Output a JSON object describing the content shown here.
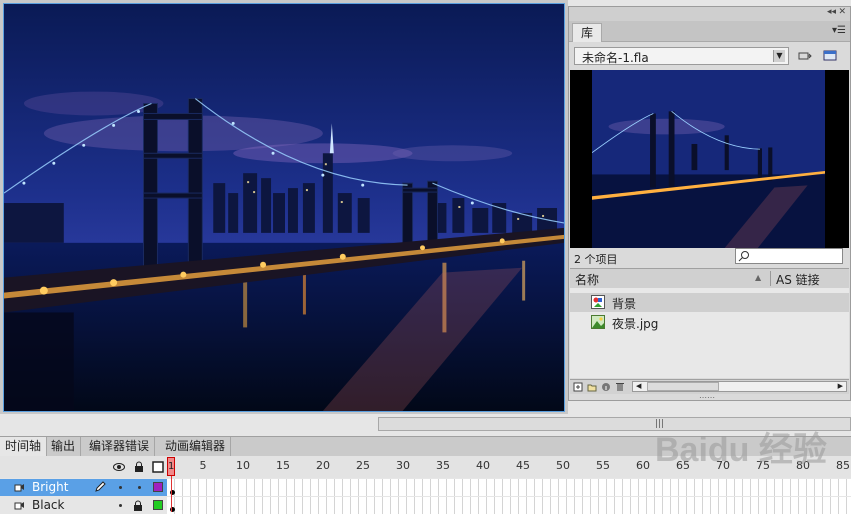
{
  "library": {
    "tab": "库",
    "document": "未命名-1.fla",
    "items_count": "2 个项目",
    "col_name": "名称",
    "col_linkage": "AS 链接",
    "items": [
      {
        "name": "背景",
        "icon": "graphic-symbol-icon",
        "selected": true
      },
      {
        "name": "夜景.jpg",
        "icon": "bitmap-icon",
        "selected": false
      }
    ]
  },
  "timeline": {
    "tabs": [
      "时间轴",
      "输出",
      "编译器错误",
      "动画编辑器"
    ],
    "current_frame": "1",
    "ruler": [
      "5",
      "10",
      "15",
      "20",
      "25",
      "30",
      "35",
      "40",
      "45",
      "50",
      "55",
      "60",
      "65",
      "70",
      "75",
      "80",
      "85"
    ],
    "layers": [
      {
        "name": "Bright",
        "color": "#a020c0",
        "selected": true
      },
      {
        "name": "Black",
        "color": "#22cc22",
        "selected": false
      }
    ]
  },
  "watermark": "Baidu 经验",
  "colors": {
    "selection": "#5aa0e6",
    "playhead": "#e03333"
  }
}
